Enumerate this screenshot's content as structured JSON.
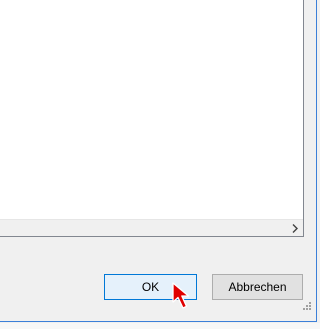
{
  "dialog": {
    "ok_label": "OK",
    "cancel_label": "Abbrechen"
  },
  "icons": {
    "scroll_right": "chevron-right-icon",
    "resize": "resize-grip-icon",
    "cursor": "mouse-pointer-icon"
  },
  "colors": {
    "accent": "#0078d7",
    "window_border": "#3b7fd8",
    "cursor": "#e00000"
  }
}
